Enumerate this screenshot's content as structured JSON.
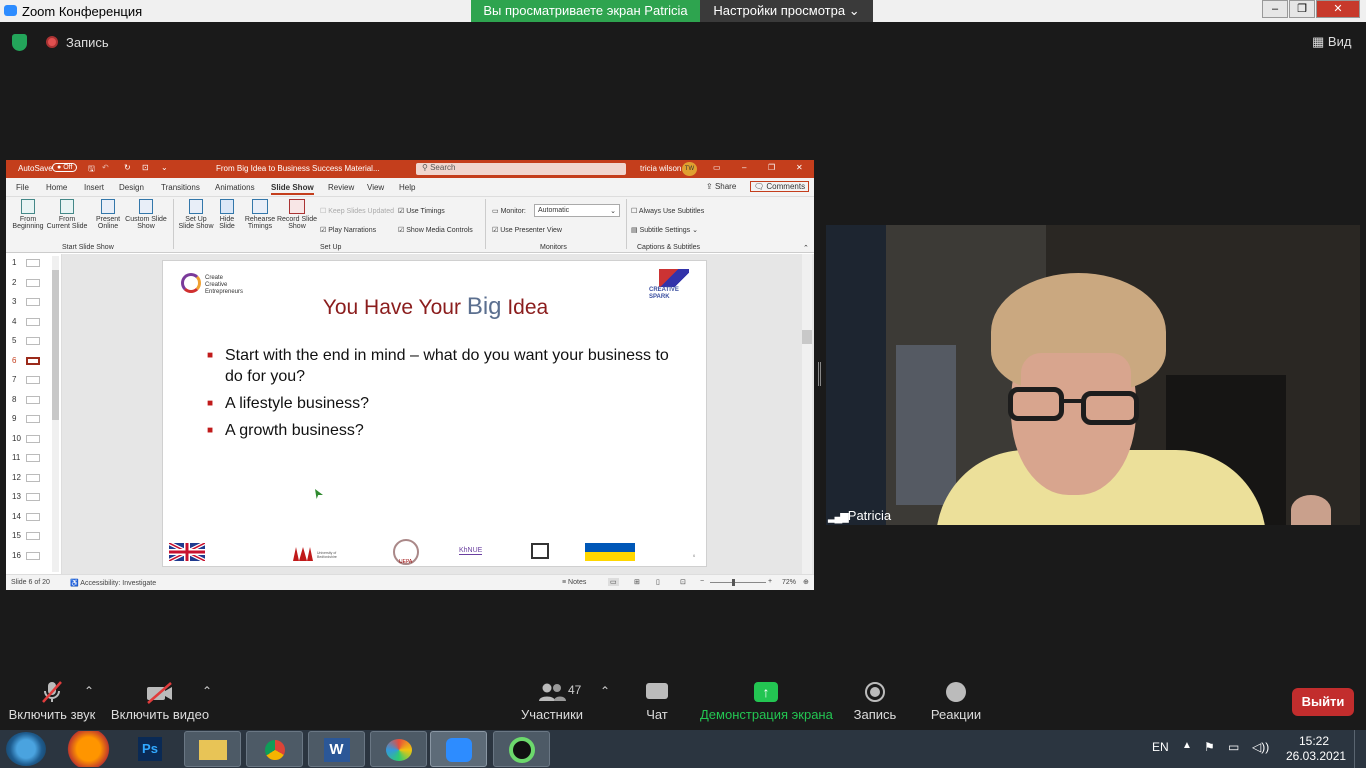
{
  "titlebar": {
    "app_title": "Zoom Конференция",
    "share_banner": "Вы просматриваете экран Patricia",
    "view_settings": "Настройки просмотра"
  },
  "topstrip": {
    "record_label": "Запись",
    "view_label": "Вид"
  },
  "ppt": {
    "autosave": "AutoSave",
    "autosave_state": "Off",
    "doc_title": "From Big Idea to Business Success Material...",
    "search_placeholder": "Search",
    "user_name": "tricia wilson",
    "user_initials": "TW",
    "tabs": [
      "File",
      "Home",
      "Insert",
      "Design",
      "Transitions",
      "Animations",
      "Slide Show",
      "Review",
      "View",
      "Help"
    ],
    "active_tab": "Slide Show",
    "share_label": "Share",
    "comments_label": "Comments",
    "ribbon": {
      "from_beginning": [
        "From",
        "Beginning"
      ],
      "from_current": [
        "From",
        "Current Slide"
      ],
      "present_online": [
        "Present",
        "Online"
      ],
      "custom_show": [
        "Custom Slide",
        "Show"
      ],
      "group_start": "Start Slide Show",
      "setup_show": [
        "Set Up",
        "Slide Show"
      ],
      "hide_slide": [
        "Hide",
        "Slide"
      ],
      "rehearse": [
        "Rehearse",
        "Timings"
      ],
      "record": [
        "Record Slide",
        "Show"
      ],
      "keep_updated": "Keep Slides Updated",
      "play_narrations": "Play Narrations",
      "use_timings": "Use Timings",
      "show_media": "Show Media Controls",
      "group_setup": "Set Up",
      "monitor_label": "Monitor:",
      "monitor_value": "Automatic",
      "presenter_view": "Use Presenter View",
      "group_monitors": "Monitors",
      "always_subtitles": "Always Use Subtitles",
      "subtitle_settings": "Subtitle Settings",
      "group_captions": "Captions & Subtitles"
    },
    "slide_numbers": [
      "1",
      "2",
      "3",
      "4",
      "5",
      "6",
      "7",
      "8",
      "9",
      "10",
      "11",
      "12",
      "13",
      "14",
      "15",
      "16"
    ],
    "active_slide": "6",
    "slide": {
      "logo_left": [
        "Create",
        "Creative",
        "Entrepreneurs"
      ],
      "logo_right": [
        "CREATIVE",
        "SPARK"
      ],
      "title_part1": "You Have Your ",
      "title_part2": "Big",
      "title_part3": " Idea",
      "bullets": [
        "Start with the end in mind – what do you want your business to do for you?",
        "A lifestyle business?",
        "A growth business?"
      ],
      "footer_logo_2": "University of Bedfordshire",
      "footer_logo_3": "UEPA",
      "footer_logo_4": "KhNUE",
      "slide_num": "6"
    },
    "status": {
      "slide_of": "Slide 6 of 20",
      "accessibility": "Accessibility: Investigate",
      "notes": "Notes",
      "zoom": "72%"
    }
  },
  "video": {
    "participant_name": "Patricia"
  },
  "toolbar": {
    "audio": "Включить звук",
    "video": "Включить видео",
    "participants": "Участники",
    "participants_count": "47",
    "chat": "Чат",
    "share": "Демонстрация экрана",
    "record": "Запись",
    "reactions": "Реакции",
    "leave": "Выйти"
  },
  "taskbar": {
    "lang": "EN",
    "time": "15:22",
    "date": "26.03.2021"
  },
  "colors": {
    "accent_red": "#c43e1c",
    "slide_title_red": "#8b1d1d",
    "slide_title_blue": "#5b6f8f",
    "zoom_green": "#2ea44f",
    "leave_red": "#c22d2d"
  }
}
